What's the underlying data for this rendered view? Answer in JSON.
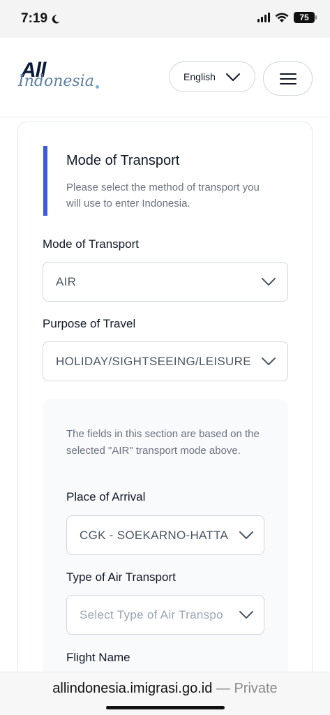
{
  "status": {
    "time": "7:19",
    "battery": "75"
  },
  "header": {
    "logo_all": "All",
    "logo_indonesia": "Indonesia",
    "language": "English"
  },
  "section": {
    "title": "Mode of Transport",
    "description": "Please select the method of transport you will use to enter Indonesia."
  },
  "fields": {
    "mode_label": "Mode of Transport",
    "mode_value": "AIR",
    "purpose_label": "Purpose of Travel",
    "purpose_value": "HOLIDAY/SIGHTSEEING/LEISURE"
  },
  "air_section": {
    "description": "The fields in this section are based on the selected \"AIR\" transport mode above.",
    "arrival_label": "Place of Arrival",
    "arrival_value": "CGK - SOEKARNO-HATTA",
    "air_type_label": "Type of Air Transport",
    "air_type_placeholder": "Select Type of Air Transpo",
    "flight_name_label": "Flight Name"
  },
  "browser": {
    "domain": "allindonesia.imigrasi.go.id",
    "separator": " — ",
    "mode": "Private"
  },
  "colors": {
    "accent": "#3b5bdb",
    "text_dark": "#111827",
    "text_muted": "#6b7280"
  }
}
